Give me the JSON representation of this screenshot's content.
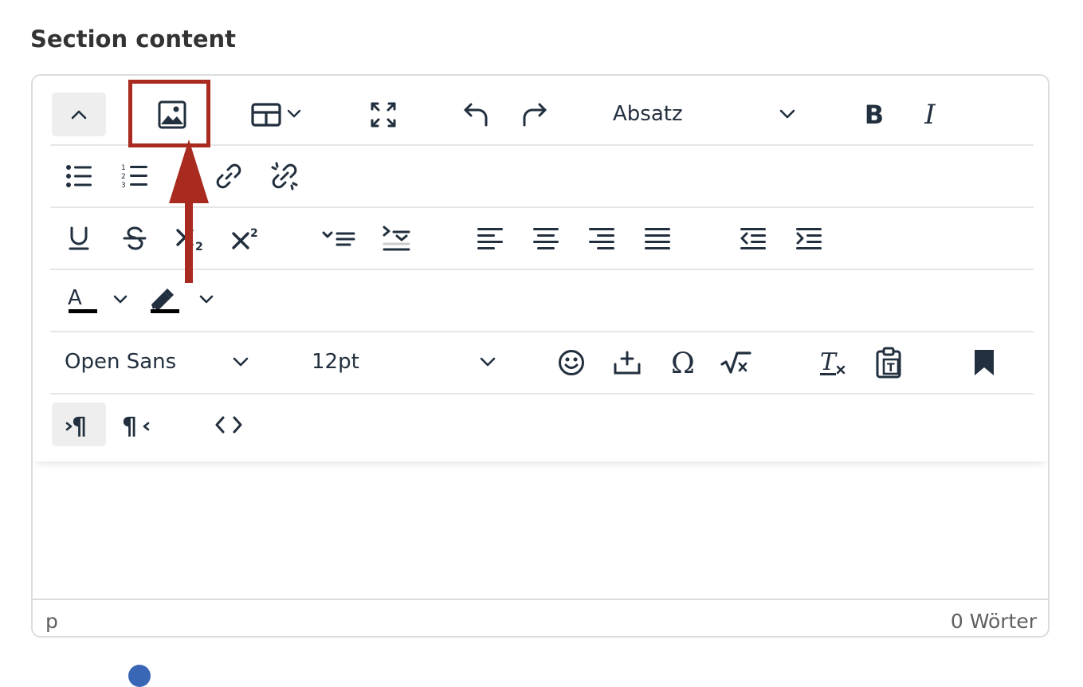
{
  "section": {
    "title": "Section content"
  },
  "toolbar": {
    "block_format": "Absatz",
    "bold_label": "B",
    "italic_label": "I",
    "font_family": "Open Sans",
    "font_size": "12pt"
  },
  "statusbar": {
    "path": "p",
    "word_count": "0 Wörter"
  },
  "colors": {
    "accent_annotation": "#a92a1f",
    "icon": "#222f3e",
    "active_bg": "#eeeeee"
  },
  "icons": [
    "chevron-up-icon",
    "image-icon",
    "table-icon",
    "fullscreen-icon",
    "undo-icon",
    "redo-icon",
    "bullet-list-icon",
    "numbered-list-icon",
    "link-icon",
    "unlink-icon",
    "underline-icon",
    "strikethrough-icon",
    "subscript-icon",
    "superscript-icon",
    "ltr-icon",
    "rtl-icon",
    "align-left-icon",
    "align-center-icon",
    "align-right-icon",
    "align-justify-icon",
    "outdent-icon",
    "indent-icon",
    "text-color-icon",
    "highlight-color-icon",
    "emoticon-icon",
    "insert-icon",
    "omega-icon",
    "math-icon",
    "clear-format-icon",
    "paste-text-icon",
    "bookmark-icon",
    "paragraph-ltr-icon",
    "paragraph-rtl-icon",
    "code-icon"
  ]
}
